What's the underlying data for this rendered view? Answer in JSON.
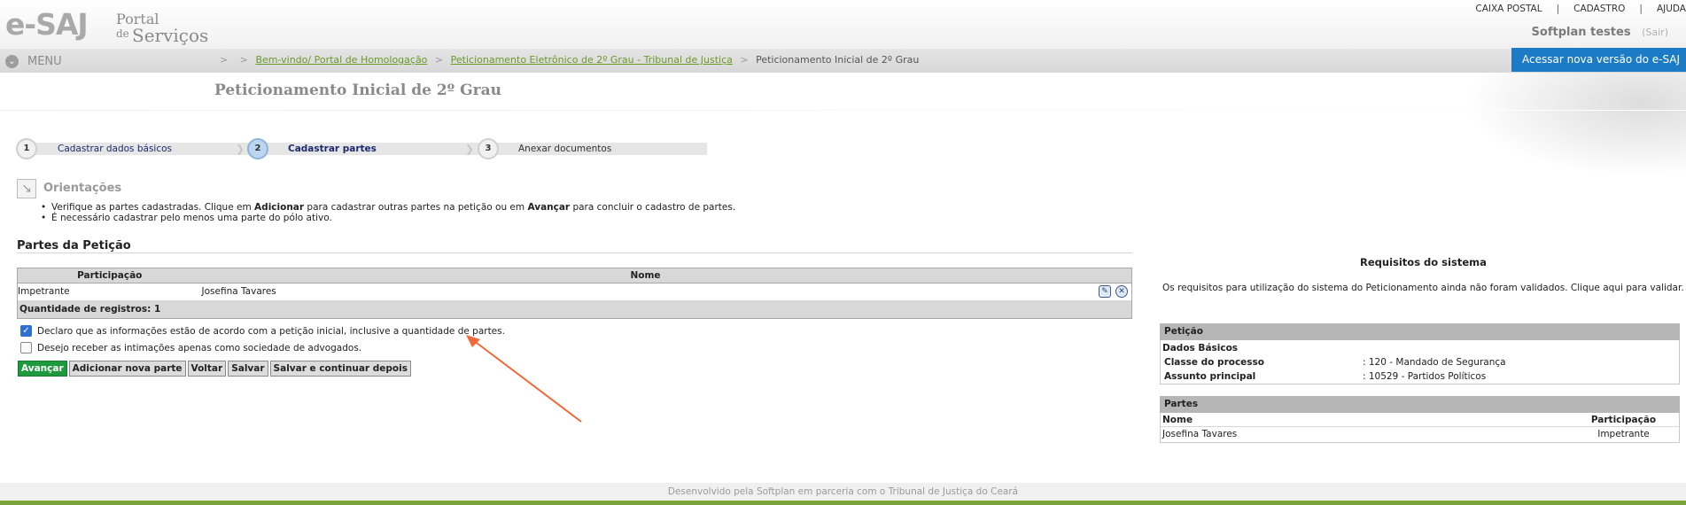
{
  "header": {
    "logo": {
      "esaj": "e-SAJ",
      "portal": "Portal",
      "de": "de",
      "servicos": "Serviços"
    },
    "toplinks": [
      "CAIXA POSTAL",
      "CADASTRO",
      "AJUDA"
    ],
    "separator": "|",
    "user": {
      "name": "Softplan testes",
      "logout": "(Sair)"
    },
    "menu_label": "MENU",
    "new_version_button": "Acessar nova versão do e-SAJ"
  },
  "breadcrumb": {
    "separator": ">",
    "items": [
      "Bem-vindo/ Portal de Homologação",
      "Peticionamento Eletrônico de 2º Grau - Tribunal de Justiça",
      "Peticionamento Inicial de 2º Grau"
    ]
  },
  "page_title": "Peticionamento Inicial de 2º Grau",
  "stepper": {
    "steps": [
      {
        "number": "1",
        "label": "Cadastrar dados básicos",
        "state": "done"
      },
      {
        "number": "2",
        "label": "Cadastrar partes",
        "state": "active"
      },
      {
        "number": "3",
        "label": "Anexar documentos",
        "state": "pending"
      }
    ]
  },
  "orientacoes": {
    "title": "Orientações",
    "items": [
      {
        "before": "Verifique as partes cadastradas. Clique em ",
        "b1": "Adicionar",
        "middle": " para cadastrar outras partes na petição ou em ",
        "b2": "Avançar",
        "after": " para concluir o cadastro de partes."
      },
      {
        "text": "É necessário cadastrar pelo menos uma parte do pólo ativo."
      }
    ]
  },
  "partes": {
    "title": "Partes da Petição",
    "columns": [
      "Participação",
      "Nome"
    ],
    "rows": [
      {
        "participacao": "Impetrante",
        "nome": "Josefina Tavares"
      }
    ],
    "count_label": "Quantidade de registros: 1"
  },
  "checkboxes": [
    {
      "label": "Declaro que as informações estão de acordo com a petição inicial, inclusive a quantidade de partes.",
      "checked": true
    },
    {
      "label": "Desejo receber as intimações apenas como sociedade de advogados.",
      "checked": false
    }
  ],
  "buttons": [
    "Avançar",
    "Adicionar nova parte",
    "Voltar",
    "Salvar",
    "Salvar e continuar depois"
  ],
  "requisitos": {
    "title": "Requisitos do sistema",
    "text": "Os requisitos para utilização do sistema do Peticionamento ainda não foram validados. Clique aqui para validar."
  },
  "resumo": {
    "peticao_header": "Petição",
    "dados_basicos": "Dados Básicos",
    "fields": [
      {
        "label": "Classe do processo",
        "value": ": 120 - Mandado de Segurança"
      },
      {
        "label": "Assunto principal",
        "value": ": 10529 - Partidos Políticos"
      }
    ],
    "partes_header": "Partes",
    "partes_columns": [
      "Nome",
      "Participação"
    ],
    "partes_rows": [
      {
        "nome": "Josefina Tavares",
        "participacao": "Impetrante"
      }
    ]
  },
  "footer": "Desenvolvido pela Softplan em parceria com o Tribunal de Justiça do Ceará",
  "colors": {
    "accent_blue": "#1d7bc6",
    "primary_button": "#1e9a3e",
    "breadcrumb_link": "#6a9a2a",
    "annotation_arrow": "#f0693a"
  }
}
